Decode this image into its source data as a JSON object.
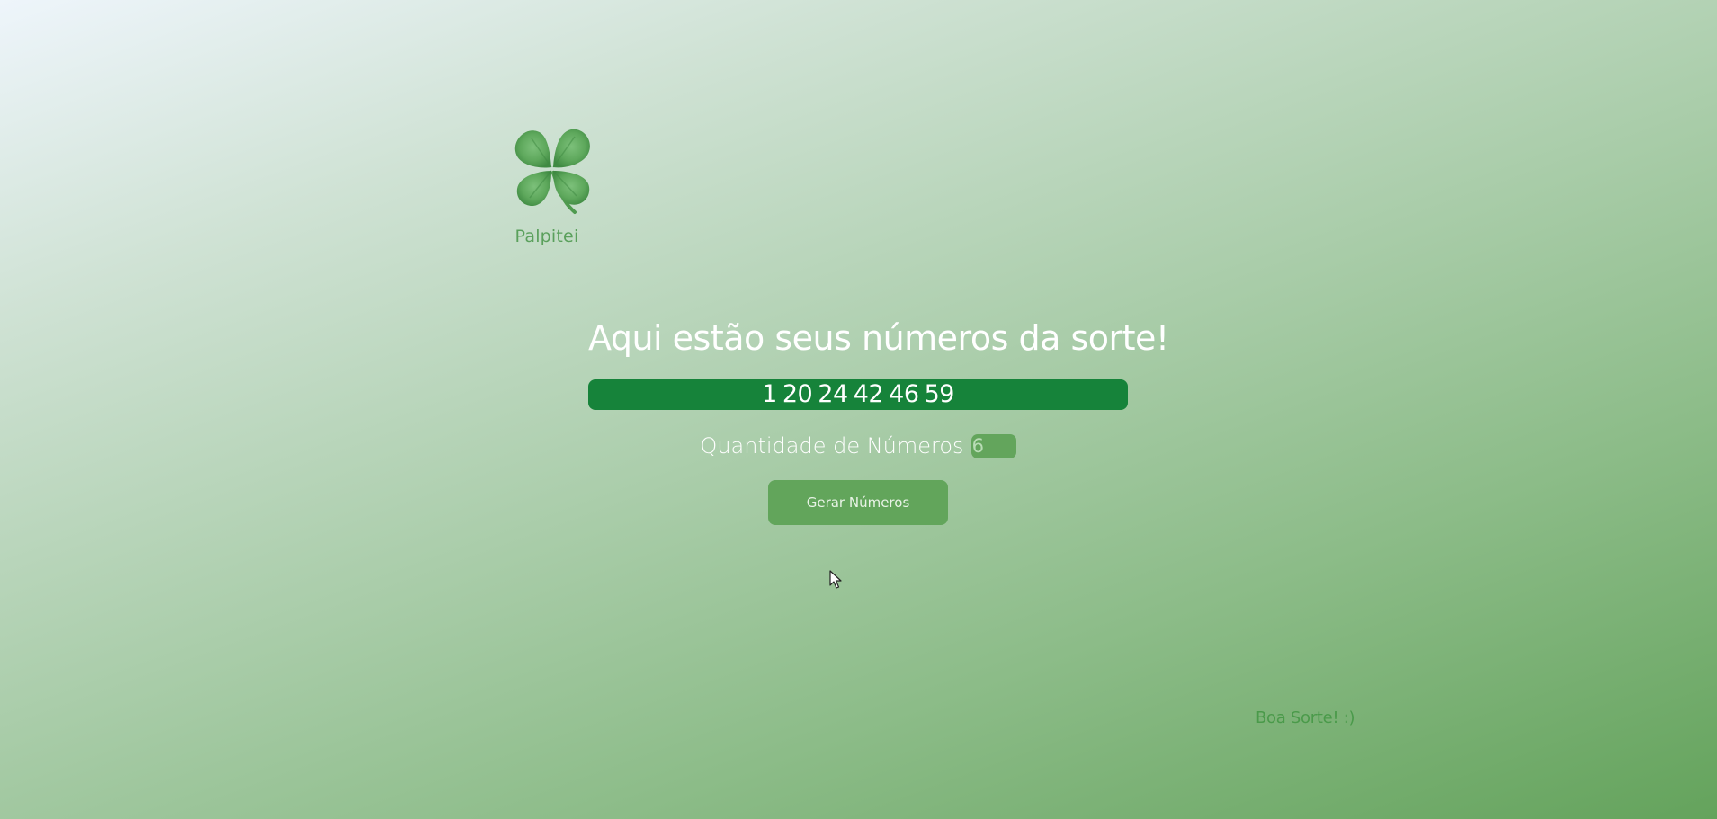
{
  "logo": {
    "icon": "four-leaf-clover-icon",
    "label": "Palpitei"
  },
  "main": {
    "headline": "Aqui estão seus números da sorte!",
    "numbers": "1 20 24 42 46 59",
    "quantity_label": "Quantidade de Números",
    "quantity_value": "6",
    "generate_button": "Gerar Números"
  },
  "footer": {
    "message": "Boa Sorte! :)"
  },
  "colors": {
    "numbers_bar": "#16833a",
    "button": "#62a55b",
    "brand_green": "#5aa05c"
  }
}
